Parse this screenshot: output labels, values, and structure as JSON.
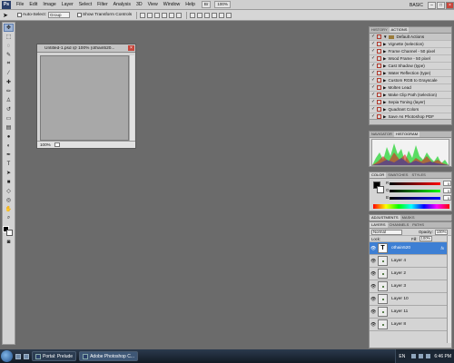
{
  "menubar": {
    "logo": "Ps",
    "items": [
      "File",
      "Edit",
      "Image",
      "Layer",
      "Select",
      "Filter",
      "Analysis",
      "3D",
      "View",
      "Window",
      "Help"
    ],
    "zoom": "100%",
    "workspace": "BASIC"
  },
  "options": {
    "auto_select_label": "Auto-Select:",
    "auto_select_value": "Group",
    "show_transform_label": "Show Transform Controls"
  },
  "document": {
    "title": "Untitled-1.psd @ 100% (othain520...",
    "zoom": "100%"
  },
  "actions_panel": {
    "tabs": [
      "HISTORY",
      "ACTIONS"
    ],
    "set_name": "Default Actions",
    "items": [
      "Vignette (selection)",
      "Frame Channel - 50 pixel",
      "Wood Frame - 50 pixel",
      "Cast Shadow (type)",
      "Water Reflection (type)",
      "Custom RGB to Grayscale",
      "Molten Lead",
      "Make Clip Path (selection)",
      "Sepia Toning (layer)",
      "Quadrant Colors",
      "Save As Photoshop PDF"
    ]
  },
  "histogram_panel": {
    "tabs": [
      "NAVIGATOR",
      "HISTOGRAM"
    ]
  },
  "color_panel": {
    "tabs": [
      "COLOR",
      "SWATCHES",
      "STYLES"
    ],
    "channels": [
      "R",
      "G",
      "B"
    ],
    "values": [
      "0",
      "0",
      "0"
    ]
  },
  "adjust_panel": {
    "tabs": [
      "ADJUSTMENTS",
      "MASKS"
    ]
  },
  "layers_panel": {
    "tabs": [
      "LAYERS",
      "CHANNELS",
      "PATHS"
    ],
    "blend_mode": "Normal",
    "opacity_label": "Opacity:",
    "opacity": "100%",
    "lock_label": "Lock:",
    "fill_label": "Fill:",
    "fill": "100%",
    "layers": [
      {
        "name": "othain520",
        "thumb": "T",
        "fx": "fx"
      },
      {
        "name": "Layer 4"
      },
      {
        "name": "Layer 2"
      },
      {
        "name": "Layer 3"
      },
      {
        "name": "Layer 10"
      },
      {
        "name": "Layer 11"
      },
      {
        "name": "Layer 8"
      }
    ]
  },
  "taskbar": {
    "tasks": [
      "Portal: Prelude",
      "Adobe Photoshop C..."
    ],
    "lang": "EN",
    "time": "6:46 PM"
  }
}
